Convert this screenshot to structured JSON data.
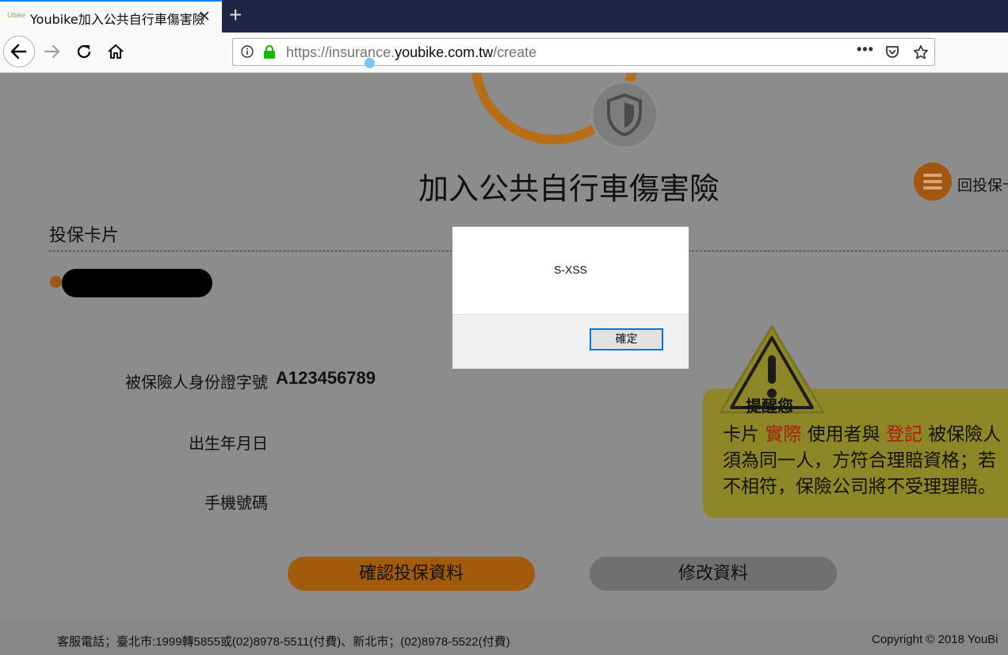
{
  "browser": {
    "tab_title": "Youbike加入公共自行車傷害險",
    "favicon_text": "Ubike",
    "url_prefix": "https://insurance.",
    "url_domain": "youbike.com.tw",
    "url_path": "/create"
  },
  "page": {
    "title": "加入公共自行車傷害險",
    "back_link": "回投保卡",
    "card_heading": "投保卡片",
    "form": {
      "id_label": "被保險人身份證字號",
      "id_value": "A123456789",
      "birth_label": "出生年月日",
      "phone_label": "手機號碼"
    },
    "reminder": {
      "badge": "提醒您",
      "line1_a": "卡片 ",
      "line1_red1": "實際",
      "line1_b": " 使用者與 ",
      "line1_red2": "登記",
      "line1_c": " 被保險人",
      "line2": "須為同一人，方符合理賠資格；若",
      "line3": "不相符，保險公司將不受理理賠。"
    },
    "buttons": {
      "confirm": "確認投保資料",
      "edit": "修改資料"
    },
    "footer": {
      "contact": "客服電話；臺北市:1999轉5855或(02)8978-5511(付費)、新北市；(02)8978-5522(付費)",
      "copyright": "Copyright © 2018 YouBi"
    }
  },
  "dialog": {
    "message": "S-XSS",
    "ok_label": "確定"
  },
  "colors": {
    "tab_strip": "#1f2545",
    "accent_tab": "#0a84ff",
    "overlay_gray": "#8c8c8c",
    "brand_orange": "#a15b0a",
    "reminder_red": "#a81c0c"
  }
}
